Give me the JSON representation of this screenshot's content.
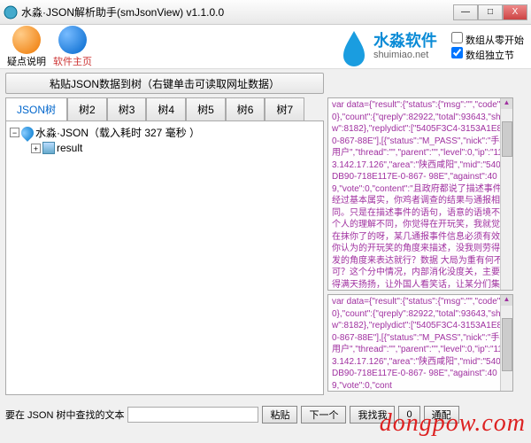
{
  "window": {
    "title": "水淼·JSON解析助手(smJsonView) v1.1.0.0",
    "min": "—",
    "max": "□",
    "close": "X"
  },
  "toolbar": {
    "help_label": "疑点说明",
    "home_label": "软件主页"
  },
  "brand": {
    "cn": "水淼软件",
    "url": "shuimiao.net"
  },
  "options": {
    "opt1": "数组从零开始",
    "opt2": "数组独立节"
  },
  "paste": {
    "label": "粘贴JSON数据到树（右键单击可读取网址数据）"
  },
  "tabs": [
    "JSON树",
    "树2",
    "树3",
    "树4",
    "树5",
    "树6",
    "树7"
  ],
  "tree": {
    "root": "水淼·JSON（载入耗时 327 毫秒 ）",
    "child": "result"
  },
  "code_top": "var data={\"result\":{\"status\":{\"msg\":\"\",\"code\":0},\"count\":{\"qreply\":82922,\"total\":93643,\"show\":8182},\"replydict\":[\"5405F3C4-3153A1E8-0-867-88E\"],[{\"status\":\"M_PASS\",\"nick\":\"手机用户\",\"thread\":\"\",\"parent\":\"\",\"level\":0,\"ip\":\"113.142.17.126\",\"area\":\"陕西咸阳\",\"mid\":\"5405DB90-718E117E-0-867-\n98E\",\"against\":409,\"vote\":0,\"content\":\"且政府都说了描述事件经过基本属实，你鸡者调查的结果与通报相同。只是在描述事件的语句，语意的语境不同个人的理解不同，你觉得在开玩笑，我就觉得在抹你了的呀，某几通报事件信息必须有效给你认为的开玩笑的角度来描述，没我则劳得头发的角度来表达就行？数据\n大局为重有何不可？这个分中情况，内部消化没度关，主要搞得满天扬扬，让外国人看笑话，让某分们集体高潮，让国家处于昏昏的负面情绪中，亲者痛，仇者快，这也师嘛\n",
  "code_bottom": "var data={\"result\":{\"status\":{\"msg\":\"\",\"code\":0},\"count\":{\"qreply\":82922,\"total\":93643,\"show\":8182},\"replydict\":[\"5405F3C4-3153A1E8-0-867-88E\"],[{\"status\":\"M_PASS\",\"nick\":\"手机用户\",\"thread\":\"\",\"parent\":\"\",\"level\":0,\"ip\":\"113.142.17.126\",\"area\":\"陕西咸阳\",\"mid\":\"5405DB90-718E117E-0-867-\n98E\",\"against\":409,\"vote\":0,\"cont",
  "search": {
    "label": "要在 JSON 树中查找的文本",
    "placeholder": "",
    "btn_paste": "粘贴",
    "btn_next": "下一个",
    "btn_r1": "我找我",
    "btn_r2": "0",
    "btn_r3": "通配"
  },
  "watermark": "dongpow.com"
}
